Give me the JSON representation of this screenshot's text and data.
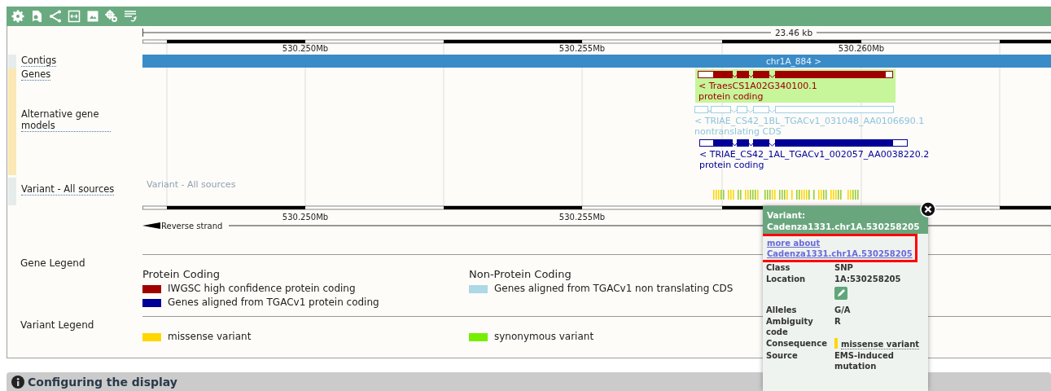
{
  "tracks": [
    {
      "label": "Contigs",
      "kind": "contig"
    },
    {
      "label": "Genes",
      "kind": "gene"
    },
    {
      "label": "Alternative gene models",
      "kind": "gene"
    },
    {
      "label": "Variant - All sources",
      "kind": "variant"
    }
  ],
  "ruler": {
    "length": "23.46 kb",
    "ticks": [
      "530.250Mb",
      "530.255Mb",
      "530.260Mb"
    ]
  },
  "contig": {
    "label": "chr1A_884 >"
  },
  "genes": [
    {
      "name": "< TraesCS1A02G340100.1",
      "biotype": "protein coding",
      "color": "#a00000",
      "kind": "filled",
      "highlighted": true
    },
    {
      "name": "< TRIAE_CS42_1BL_TGACv1_031048_AA0106690.1",
      "biotype": "nontranslating CDS",
      "color": "#9fd0e8",
      "kind": "outline",
      "highlighted": false
    },
    {
      "name": "< TRIAE_CS42_1AL_TGACv1_002057_AA0038220.2",
      "biotype": "protein coding",
      "color": "#000099",
      "kind": "filled",
      "highlighted": false
    }
  ],
  "variant_track": {
    "label": "Variant - All sources"
  },
  "bottom_ruler": {
    "ticks": [
      "530.250Mb",
      "530.255Mb"
    ],
    "strand": "Reverse strand"
  },
  "legends": [
    {
      "title": "Gene Legend",
      "groups": [
        {
          "heading": "Protein Coding",
          "items": [
            {
              "label": "IWGSC high confidence protein coding",
              "color": "#a00000"
            },
            {
              "label": "Genes aligned from TGACv1 protein coding",
              "color": "#000099"
            }
          ]
        },
        {
          "heading": "Non-Protein Coding",
          "items": [
            {
              "label": "Genes aligned from TGACv1 non translating CDS",
              "color": "#add8e6"
            }
          ]
        }
      ]
    },
    {
      "title": "Variant Legend",
      "groups": [
        {
          "items": [
            {
              "label": "missense variant",
              "color": "#ffd700"
            }
          ]
        },
        {
          "items": [
            {
              "label": "synonymous variant",
              "color": "#76ee00"
            }
          ]
        }
      ]
    }
  ],
  "popup": {
    "title": "Variant: Cadenza1331.chr1A.530258205",
    "link": {
      "text": "more about Cadenza1331.chr1A.530258205",
      "highlighted": true
    },
    "rows": [
      {
        "label": "Class",
        "value": "SNP",
        "kind": "text"
      },
      {
        "label": "Location",
        "value": "1A:530258205",
        "kind": "location"
      },
      {
        "label": "Alleles",
        "value": "G/A",
        "kind": "text"
      },
      {
        "label": "Ambiguity code",
        "value": "R",
        "kind": "text"
      },
      {
        "label": "Consequence",
        "value": "missense variant",
        "kind": "consequence",
        "color": "#ffd700"
      },
      {
        "label": "Source",
        "value": "EMS-induced mutation",
        "kind": "text"
      }
    ]
  },
  "section": {
    "title": "Configuring the display"
  }
}
